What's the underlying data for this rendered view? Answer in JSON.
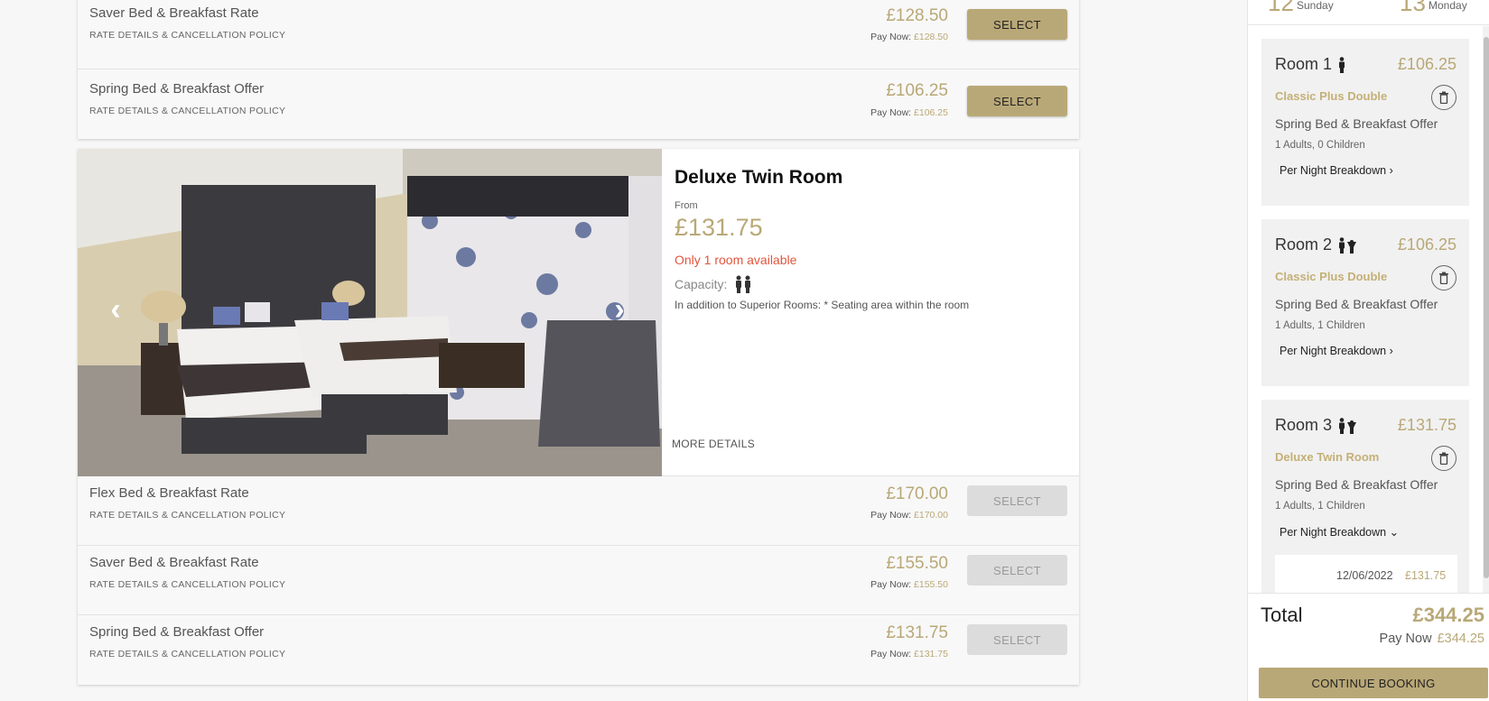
{
  "top_rates": [
    {
      "name": "Saver Bed & Breakfast Rate",
      "link": "RATE DETAILS & CANCELLATION POLICY",
      "price": "£128.50",
      "paynow_label": "Pay Now:",
      "paynow": "£128.50",
      "button": "SELECT"
    },
    {
      "name": "Spring Bed & Breakfast Offer",
      "link": "RATE DETAILS & CANCELLATION POLICY",
      "price": "£106.25",
      "paynow_label": "Pay Now:",
      "paynow": "£106.25",
      "button": "SELECT"
    }
  ],
  "room": {
    "title": "Deluxe Twin Room",
    "from_label": "From",
    "from_price": "£131.75",
    "availability": "Only 1 room available",
    "capacity_label": "Capacity:",
    "description": "In addition to Superior Rooms: * Seating area within the room",
    "more_details": "MORE DETAILS",
    "prev_icon": "chevron-left-icon",
    "next_icon": "chevron-right-icon"
  },
  "room_rates": [
    {
      "name": "Flex Bed & Breakfast Rate",
      "link": "RATE DETAILS & CANCELLATION POLICY",
      "price": "£170.00",
      "paynow_label": "Pay Now:",
      "paynow": "£170.00",
      "button": "SELECT"
    },
    {
      "name": "Saver Bed & Breakfast Rate",
      "link": "RATE DETAILS & CANCELLATION POLICY",
      "price": "£155.50",
      "paynow_label": "Pay Now:",
      "paynow": "£155.50",
      "button": "SELECT"
    },
    {
      "name": "Spring Bed & Breakfast Offer",
      "link": "RATE DETAILS & CANCELLATION POLICY",
      "price": "£131.75",
      "paynow_label": "Pay Now:",
      "paynow": "£131.75",
      "button": "SELECT"
    }
  ],
  "sidebar": {
    "dates": {
      "checkin_num": "12",
      "checkin_day": "Sunday",
      "checkout_num": "13",
      "checkout_day": "Monday"
    },
    "rooms": [
      {
        "title": "Room 1",
        "price": "£106.25",
        "type": "Classic Plus Double",
        "offer": "Spring Bed & Breakfast Offer",
        "guests": "1 Adults, 0 Children",
        "breakdown": "Per Night Breakdown",
        "chevron": "›"
      },
      {
        "title": "Room 2",
        "price": "£106.25",
        "type": "Classic Plus Double",
        "offer": "Spring Bed & Breakfast Offer",
        "guests": "1 Adults, 1 Children",
        "breakdown": "Per Night Breakdown",
        "chevron": "›"
      },
      {
        "title": "Room 3",
        "price": "£131.75",
        "type": "Deluxe Twin Room",
        "offer": "Spring Bed & Breakfast Offer",
        "guests": "1 Adults, 1 Children",
        "breakdown": "Per Night Breakdown",
        "chevron": "⌄",
        "night_date": "12/06/2022",
        "night_price": "£131.75"
      }
    ],
    "total_label": "Total",
    "total": "£344.25",
    "paynow_label": "Pay Now",
    "paynow": "£344.25",
    "continue": "CONTINUE BOOKING"
  },
  "colors": {
    "gold": "#b9a877",
    "alert": "#e2553d",
    "disabled": "#dcdcdc"
  }
}
